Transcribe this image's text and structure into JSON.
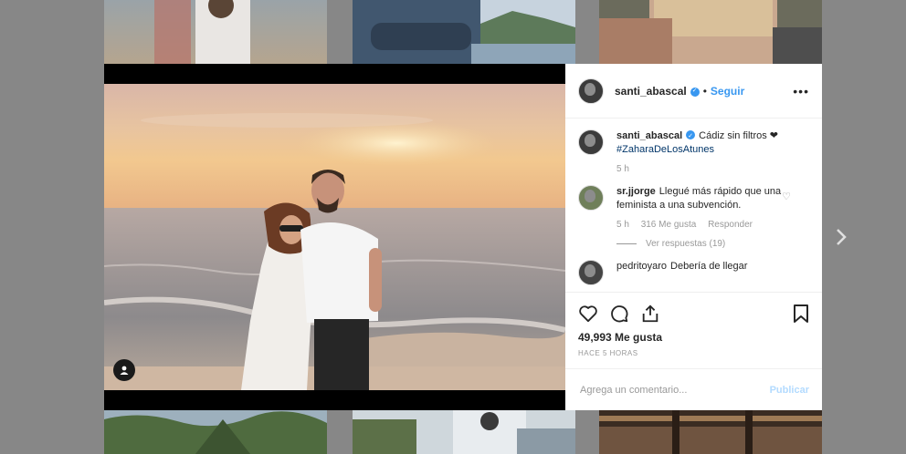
{
  "post": {
    "username": "santi_abascal",
    "follow_label": "Seguir",
    "dot": "•",
    "more_label": "•••",
    "caption": "Cádiz sin filtros",
    "caption_heart": "❤",
    "hashtag": "#ZaharaDeLosAtunes",
    "caption_age": "5 h",
    "likes": "49,993 Me gusta",
    "posted_ago": "HACE 5 HORAS"
  },
  "comments": [
    {
      "username": "sr.jjorge",
      "text": "Llegué más rápido que una feminista a una subvención.",
      "age": "5 h",
      "likes": "316 Me gusta",
      "reply_label": "Responder",
      "view_replies": "Ver respuestas (19)"
    },
    {
      "username": "pedritoyaro",
      "text": "Debería de llegar"
    }
  ],
  "comment_box": {
    "placeholder": "Agrega un comentario...",
    "publish_label": "Publicar"
  },
  "icons": {
    "like": "heart-icon",
    "comment": "comment-icon",
    "share": "share-icon",
    "save": "bookmark-icon",
    "next": "chevron-right-icon",
    "tag": "person-tag-icon"
  },
  "colors": {
    "accent": "#3897f0",
    "verified": "#3897f0",
    "backdrop": "#878787"
  }
}
